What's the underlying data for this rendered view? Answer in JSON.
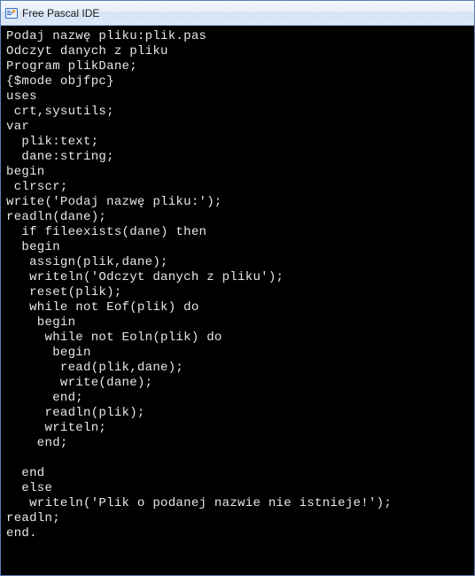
{
  "window": {
    "title": "Free Pascal IDE"
  },
  "console": {
    "lines": [
      "Podaj nazwę pliku:plik.pas",
      "Odczyt danych z pliku",
      "Program plikDane;",
      "{$mode objfpc}",
      "uses",
      " crt,sysutils;",
      "var",
      "  plik:text;",
      "  dane:string;",
      "begin",
      " clrscr;",
      "write('Podaj nazwę pliku:');",
      "readln(dane);",
      "  if fileexists(dane) then",
      "  begin",
      "   assign(plik,dane);",
      "   writeln('Odczyt danych z pliku');",
      "   reset(plik);",
      "   while not Eof(plik) do",
      "    begin",
      "     while not Eoln(plik) do",
      "      begin",
      "       read(plik,dane);",
      "       write(dane);",
      "      end;",
      "     readln(plik);",
      "     writeln;",
      "    end;",
      "",
      "  end",
      "  else",
      "   writeln('Plik o podanej nazwie nie istnieje!');",
      "readln;",
      "end."
    ]
  }
}
